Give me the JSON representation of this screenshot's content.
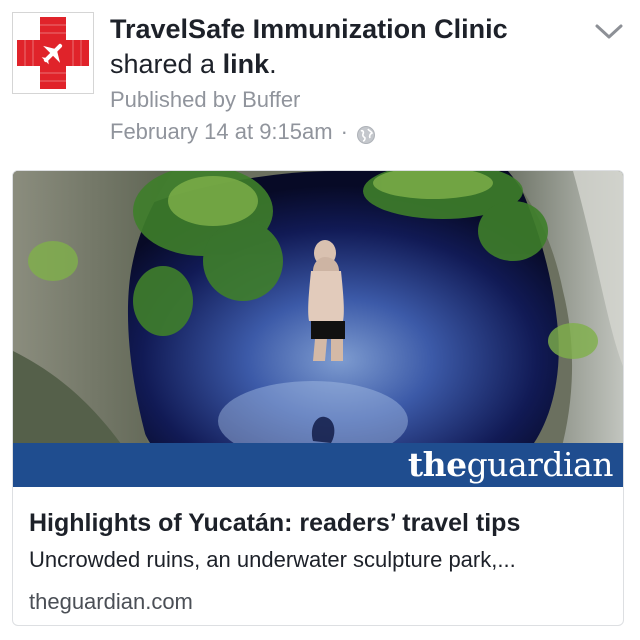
{
  "post": {
    "page_name": "TravelSafe Immunization Clinic",
    "action_prefix": "shared a ",
    "action_link_word": "link",
    "action_suffix": ".",
    "published_by": "Published by Buffer",
    "timestamp": "February 14 at 9:15am",
    "separator": "·",
    "audience_icon": "globe-icon",
    "menu_icon": "chevron-down-icon",
    "avatar_icon": "red-cross-airplane-logo"
  },
  "link_card": {
    "image_description_icon": "cenote-photo",
    "source_logo": {
      "part1": "the",
      "part2": "guardian"
    },
    "title": "Highlights of Yucatán: readers’ travel tips",
    "description": "Uncrowded ruins, an underwater sculpture park,...",
    "domain": "theguardian.com"
  },
  "colors": {
    "text_primary": "#1d2129",
    "text_secondary": "#90949c",
    "guardian_blue": "#1f4d8f",
    "cross_red": "#e0232a"
  }
}
